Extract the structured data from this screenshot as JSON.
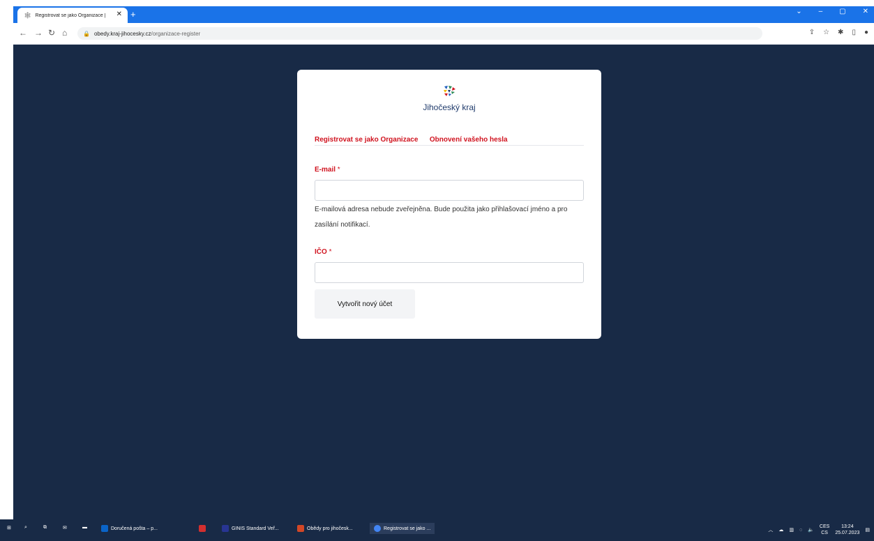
{
  "browser": {
    "tab_title": "Registrovat se jako Organizace |",
    "tab_close": "✕",
    "new_tab": "+",
    "url_host": "obedy.kraj-jihocesky.cz",
    "url_path": "/organizace-register"
  },
  "brand": {
    "name": "Jihočeský kraj"
  },
  "tabs": [
    {
      "label": "Registrovat se jako Organizace"
    },
    {
      "label": "Obnovení vašeho hesla"
    }
  ],
  "form": {
    "email_label": "E-mail",
    "email_value": "",
    "required_mark": "*",
    "email_help": "E-mailová adresa nebude zveřejněna. Bude použita jako přihlašovací jméno a pro zasílání notifikací.",
    "ico_label": "IČO",
    "ico_value": "",
    "submit_label": "Vytvořit nový účet"
  },
  "taskbar": {
    "items": [
      {
        "label": "Doručená pošta – p..."
      },
      {
        "label": "GINIS Standard Veř..."
      },
      {
        "label": "Obědy pro jihočesk..."
      },
      {
        "label": "Registrovat se jako ..."
      }
    ],
    "lang_top": "CES",
    "lang_bottom": "CS",
    "time": "13:24",
    "date": "25.07.2023"
  },
  "colors": {
    "accent": "#d0131f",
    "page_bg": "#182a46",
    "chrome": "#1a73e8"
  }
}
